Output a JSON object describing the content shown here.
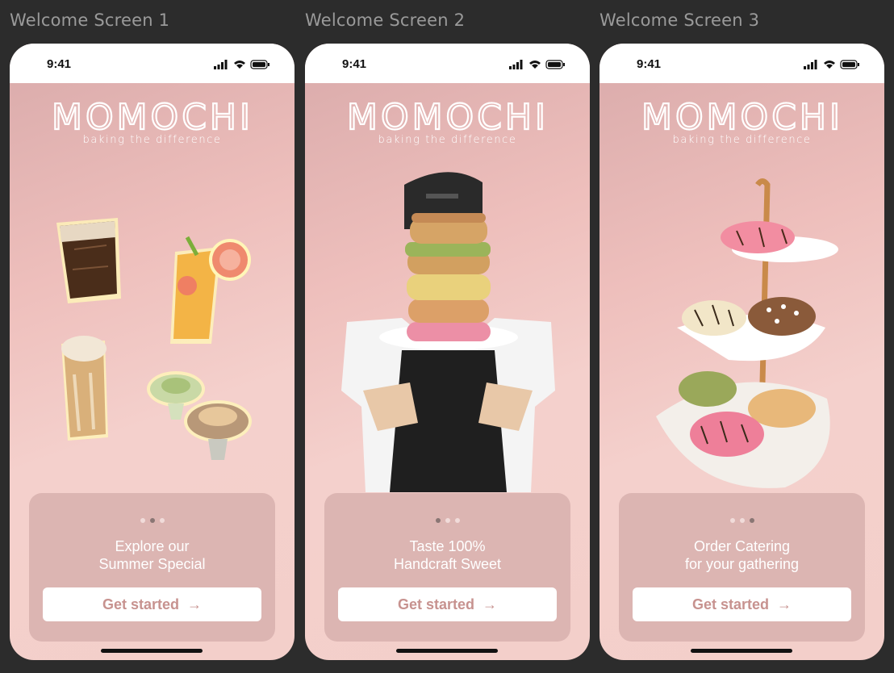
{
  "screens": [
    {
      "frame_label": "Welcome Screen 1",
      "status_time": "9:41",
      "brand": "MOMOCHI",
      "tagline": "baking the difference",
      "caption_line1": "Explore our",
      "caption_line2": "Summer Special",
      "cta_label": "Get started",
      "cta_arrow": "→",
      "active_dot": 2,
      "hero": "drinks-collage"
    },
    {
      "frame_label": "Welcome Screen 2",
      "status_time": "9:41",
      "brand": "MOMOCHI",
      "tagline": "baking the difference",
      "caption_line1": "Taste 100%",
      "caption_line2": "Handcraft Sweet",
      "cta_label": "Get started",
      "cta_arrow": "→",
      "active_dot": 1,
      "hero": "chef-holding-donut-stack"
    },
    {
      "frame_label": "Welcome Screen 3",
      "status_time": "9:41",
      "brand": "MOMOCHI",
      "tagline": "baking the difference",
      "caption_line1": "Order Catering",
      "caption_line2": "for your gathering",
      "cta_label": "Get started",
      "cta_arrow": "→",
      "active_dot": 3,
      "hero": "donut-tier-stand"
    }
  ],
  "colors": {
    "canvas": "#2c2c2c",
    "screen_gradient": "#eebfbc",
    "card": "#dcb5b2",
    "cta_text": "#c7928f",
    "dot_active": "#8a7674",
    "dot_inactive": "#f1dcda"
  }
}
